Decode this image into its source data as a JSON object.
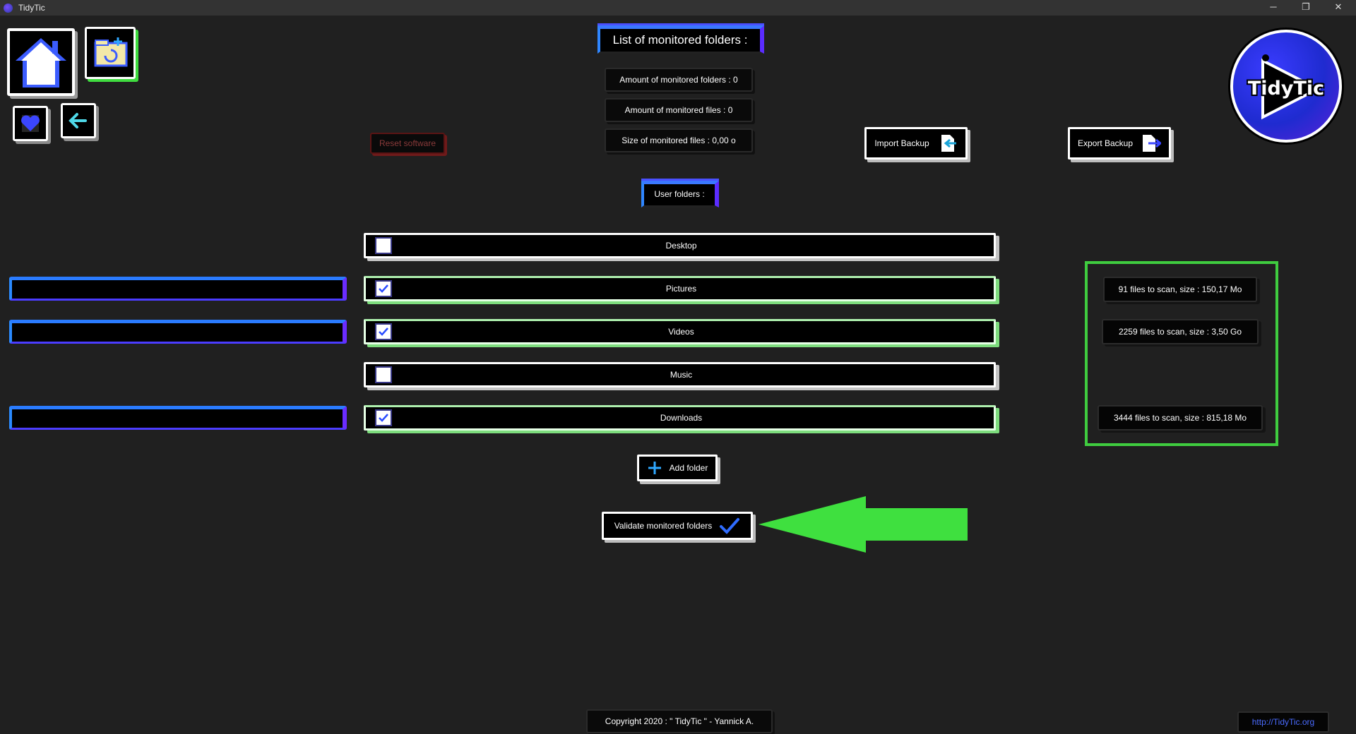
{
  "window": {
    "title": "TidyTic",
    "minimize_glyph": "─",
    "restore_glyph": "❐",
    "close_glyph": "✕"
  },
  "nav": {
    "home_icon": "home-icon",
    "folder_icon": "folder-sync-icon",
    "favorite_icon": "heart-icon",
    "back_icon": "back-arrow-icon"
  },
  "header": {
    "title": "List of monitored folders :",
    "stats": [
      "Amount of monitored folders : 0",
      "Amount of monitored files : 0",
      "Size of monitored files : 0,00 o"
    ]
  },
  "actions": {
    "reset": "Reset software",
    "import": "Import Backup",
    "export": "Export Backup",
    "add_folder": "Add folder",
    "validate": "Validate monitored folders"
  },
  "logo_text": "TidyTic",
  "user_folders_label": "User folders :",
  "folders": [
    {
      "name": "Desktop",
      "checked": false,
      "scan": ""
    },
    {
      "name": "Pictures",
      "checked": true,
      "scan": "91 files to scan, size : 150,17 Mo"
    },
    {
      "name": "Videos",
      "checked": true,
      "scan": "2259 files to scan, size : 3,50 Go"
    },
    {
      "name": "Music",
      "checked": false,
      "scan": ""
    },
    {
      "name": "Downloads",
      "checked": true,
      "scan": "3444 files to scan, size : 815,18 Mo"
    }
  ],
  "footer": {
    "copyright": "Copyright 2020 : \" TidyTic \" - Yannick A.",
    "link": "http://TidyTic.org"
  },
  "colors": {
    "background": "#202020",
    "accent_blue": "#2a7bff",
    "accent_purple": "#6b2cff",
    "highlight_green": "#3fdc3f",
    "reset_red": "#8a1d1d"
  }
}
